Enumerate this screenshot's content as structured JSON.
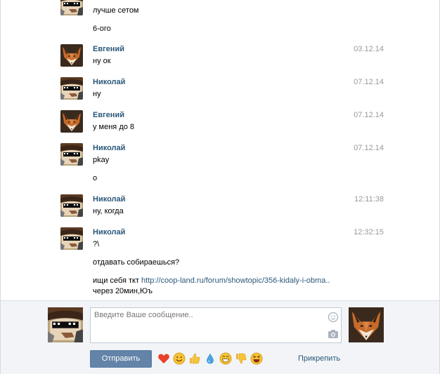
{
  "messages": [
    {
      "author": "",
      "time": "",
      "lines": [
        "лучше сетом",
        "6-ого"
      ]
    },
    {
      "author": "Евгений",
      "time": "03.12.14",
      "lines": [
        "ну ок"
      ]
    },
    {
      "author": "Николай",
      "time": "07.12.14",
      "lines": [
        "ну"
      ]
    },
    {
      "author": "Евгений",
      "time": "07.12.14",
      "lines": [
        "у меня до 8"
      ]
    },
    {
      "author": "Николай",
      "time": "07.12.14",
      "lines": [
        "pkay",
        "о"
      ]
    },
    {
      "author": "Николай",
      "time": "12:11:38",
      "lines": [
        "ну, когда"
      ]
    },
    {
      "author": "Николай",
      "time": "12:32:15",
      "lines": [
        "?\\",
        "отдавать собираешься?"
      ]
    }
  ],
  "last_message": {
    "prefix": "ищи себя ткт ",
    "link": "http://coop-land.ru/forum/showtopic/356-kidaly-i-obma..",
    "line2": "через 20мин,Юъ"
  },
  "composer": {
    "placeholder": "Введите Ваше сообщение..",
    "send_label": "Отправить",
    "attach_label": "Прикрепить",
    "emoji_icons": [
      "heart",
      "smile",
      "thumbs-up",
      "drop",
      "grin",
      "thumbs-down",
      "laugh"
    ]
  },
  "colors": {
    "link": "#2b587a",
    "time": "#999999",
    "send_button": "#6383a8",
    "composer_bg": "#f2f4f7"
  }
}
